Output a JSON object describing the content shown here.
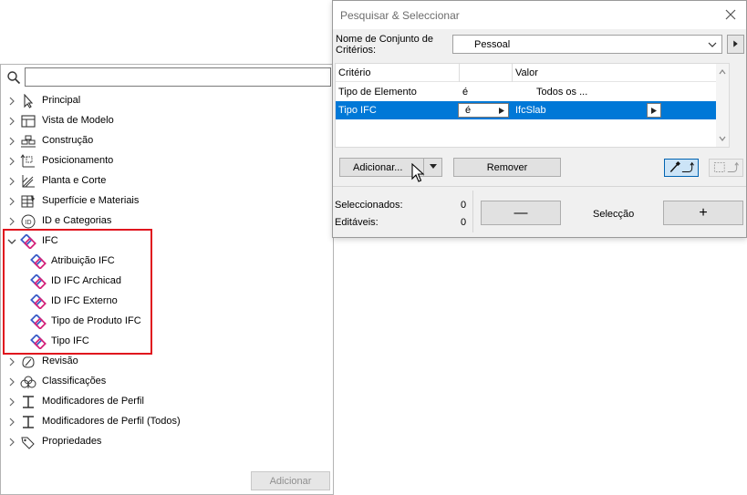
{
  "tree": {
    "search": {
      "value": "",
      "placeholder": ""
    },
    "items": [
      {
        "label": "Principal",
        "icon": "pointer-arrow-icon",
        "expanded": false
      },
      {
        "label": "Vista de Modelo",
        "icon": "model-view-icon",
        "expanded": false
      },
      {
        "label": "Construção",
        "icon": "construction-icon",
        "expanded": false
      },
      {
        "label": "Posicionamento",
        "icon": "positioning-icon",
        "expanded": false
      },
      {
        "label": "Planta e Corte",
        "icon": "floor-plan-section-icon",
        "expanded": false
      },
      {
        "label": "Superfície e Materiais",
        "icon": "surface-materials-icon",
        "expanded": false
      },
      {
        "label": "ID e Categorias",
        "icon": "id-categories-icon",
        "expanded": false
      },
      {
        "label": "IFC",
        "icon": "ifc-icon",
        "expanded": true
      },
      {
        "label": "Revisão",
        "icon": "revision-icon",
        "expanded": false
      },
      {
        "label": "Classificações",
        "icon": "classifications-icon",
        "expanded": false
      },
      {
        "label": "Modificadores de Perfil",
        "icon": "profile-modifiers-icon",
        "expanded": false
      },
      {
        "label": "Modificadores de Perfil (Todos)",
        "icon": "profile-modifiers-all-icon",
        "expanded": false
      },
      {
        "label": "Propriedades",
        "icon": "properties-tag-icon",
        "expanded": false
      }
    ],
    "ifc_children": [
      {
        "label": "Atribuição IFC",
        "icon": "ifc-icon"
      },
      {
        "label": "ID IFC Archicad",
        "icon": "ifc-icon"
      },
      {
        "label": "ID IFC Externo",
        "icon": "ifc-icon"
      },
      {
        "label": "Tipo de Produto IFC",
        "icon": "ifc-icon"
      },
      {
        "label": "Tipo IFC",
        "icon": "ifc-icon"
      }
    ],
    "add_button": "Adicionar",
    "add_button_enabled": false
  },
  "dialog": {
    "title": "Pesquisar & Seleccionar",
    "criteria_set_label": "Nome de Conjunto de Critérios:",
    "criteria_set_value": "Pessoal",
    "table": {
      "headers": [
        "Critério",
        "",
        "Valor"
      ],
      "rows": [
        {
          "criterion": "Tipo de Elemento",
          "operator": "é",
          "value": "Todos os ...",
          "selected": false
        },
        {
          "criterion": "Tipo IFC",
          "operator": "é",
          "value": "IfcSlab",
          "selected": true
        }
      ]
    },
    "add_button": "Adicionar...",
    "remove_button": "Remover",
    "selected_label": "Seleccionados:",
    "selected_count": "0",
    "editable_label": "Editáveis:",
    "editable_count": "0",
    "deselect_symbol": "—",
    "selection_label": "Selecção",
    "select_symbol": "+"
  },
  "colors": {
    "selection_blue": "#0078d7",
    "highlight_red": "#e0141e",
    "ifc_icon_blue": "#3a5bc7",
    "ifc_icon_magenta": "#d4237a"
  }
}
